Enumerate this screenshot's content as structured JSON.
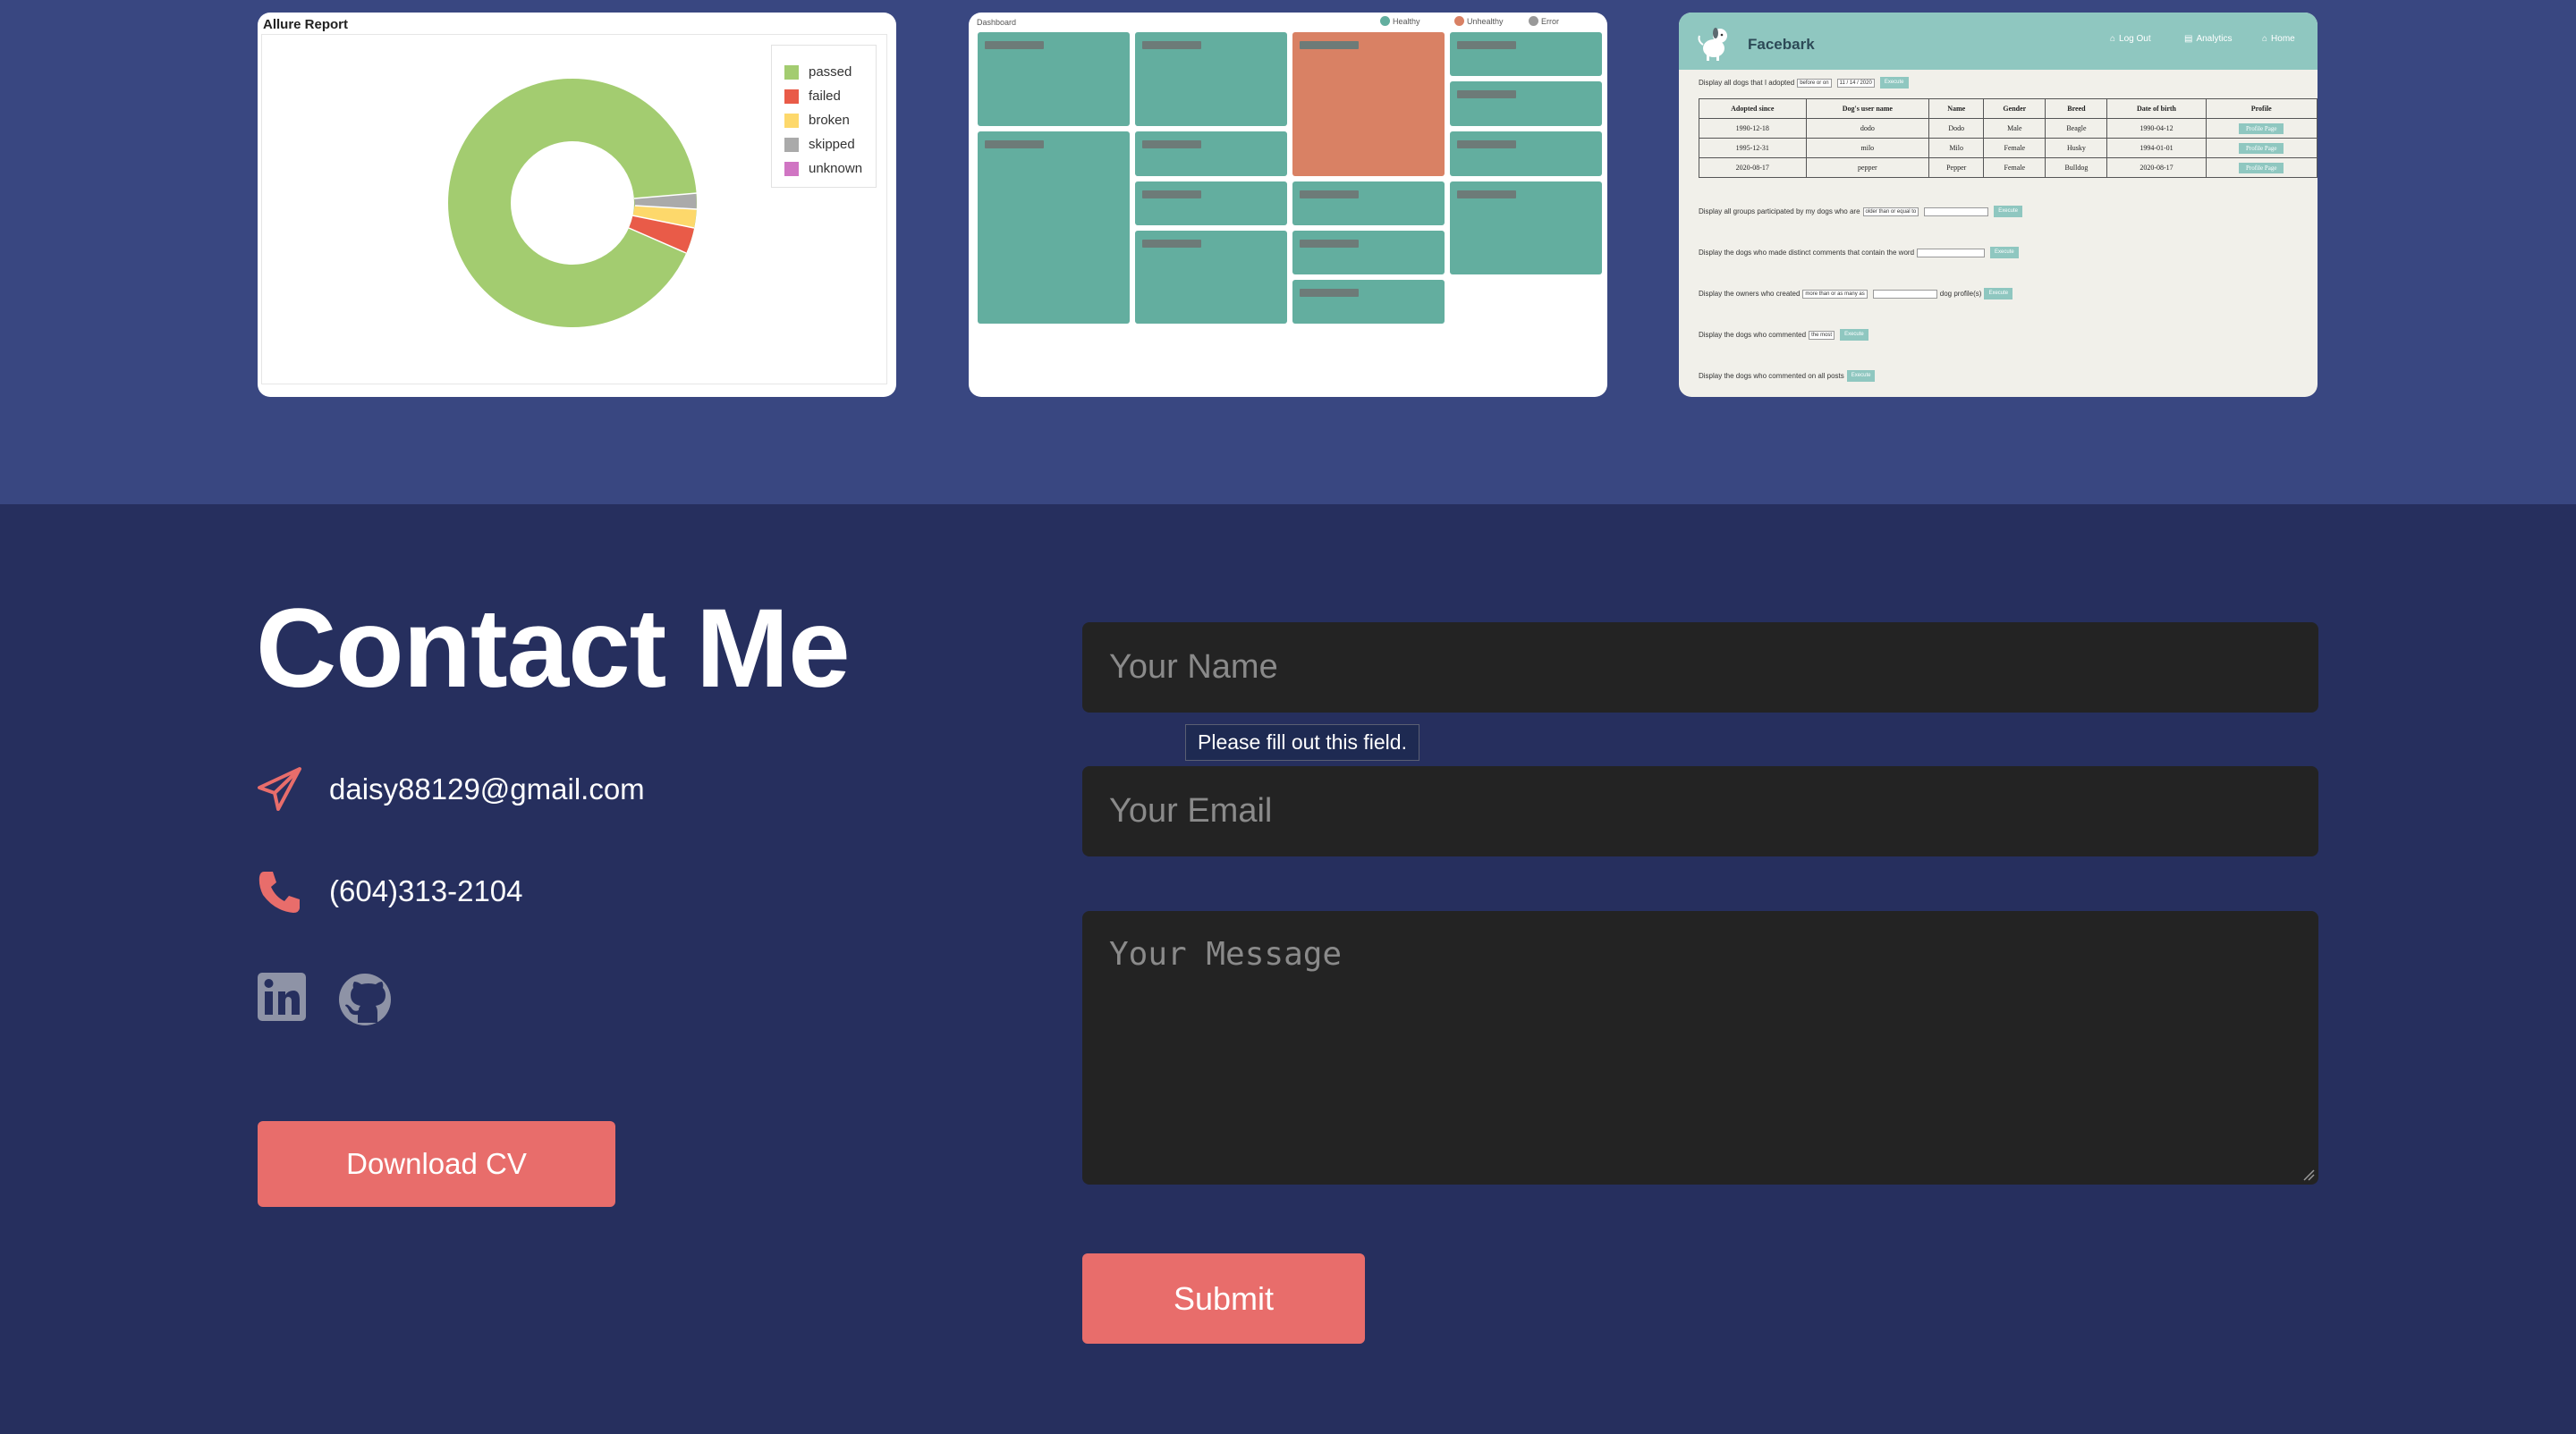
{
  "projects": {
    "allure": {
      "title": "Allure Report",
      "legend": [
        {
          "label": "passed",
          "color": "#a3cc70"
        },
        {
          "label": "failed",
          "color": "#e95b48"
        },
        {
          "label": "broken",
          "color": "#fdd86b"
        },
        {
          "label": "skipped",
          "color": "#aaaaaa"
        },
        {
          "label": "unknown",
          "color": "#d075c3"
        }
      ]
    },
    "dashboard": {
      "label": "Dashboard",
      "legend": [
        {
          "label": "Healthy",
          "color": "#63ae9f"
        },
        {
          "label": "Unhealthy",
          "color": "#d98164"
        },
        {
          "label": "Error",
          "color": "#999999"
        }
      ]
    },
    "facebark": {
      "brand": "Facebark",
      "nav": [
        {
          "icon": "⌂",
          "label": "Log Out"
        },
        {
          "icon": "▤",
          "label": "Analytics"
        },
        {
          "icon": "⌂",
          "label": "Home"
        }
      ],
      "query1": {
        "text": "Display all dogs that I adopted",
        "select": "before or on",
        "date": "11 / 14 / 2020",
        "button": "Execute"
      },
      "table": {
        "headers": [
          "Adopted since",
          "Dog's user name",
          "Name",
          "Gender",
          "Breed",
          "Date of birth",
          "Profile"
        ],
        "rows": [
          [
            "1990-12-18",
            "dodo",
            "Dodo",
            "Male",
            "Beagle",
            "1990-04-12",
            "Profile Page"
          ],
          [
            "1995-12-31",
            "milo",
            "Milo",
            "Female",
            "Husky",
            "1994-01-01",
            "Profile Page"
          ],
          [
            "2020-08-17",
            "pepper",
            "Pepper",
            "Female",
            "Bulldog",
            "2020-08-17",
            "Profile Page"
          ]
        ]
      },
      "query2": {
        "text": "Display all groups participated by my dogs who are",
        "select": "older than or equal to",
        "button": "Execute"
      },
      "query3": {
        "text": "Display the dogs who made distinct comments that contain the word",
        "button": "Execute"
      },
      "query4": {
        "text": "Display the owners who created",
        "select": "more than or as many as",
        "suffix": "dog profile(s)",
        "button": "Execute"
      },
      "query5": {
        "text": "Display the dogs who commented",
        "select": "the most",
        "button": "Execute"
      },
      "query6": {
        "text": "Display the dogs who commented on all posts",
        "button": "Execute"
      }
    }
  },
  "contact": {
    "title": "Contact Me",
    "email": "daisy88129@gmail.com",
    "phone": "(604)313-2104",
    "download_cv": "Download CV",
    "accent": "#e86d6b"
  },
  "form": {
    "name_placeholder": "Your Name",
    "email_placeholder": "Your Email",
    "message_placeholder": "Your Message",
    "validation_tooltip": "Please fill out this field.",
    "submit_label": "Submit"
  }
}
